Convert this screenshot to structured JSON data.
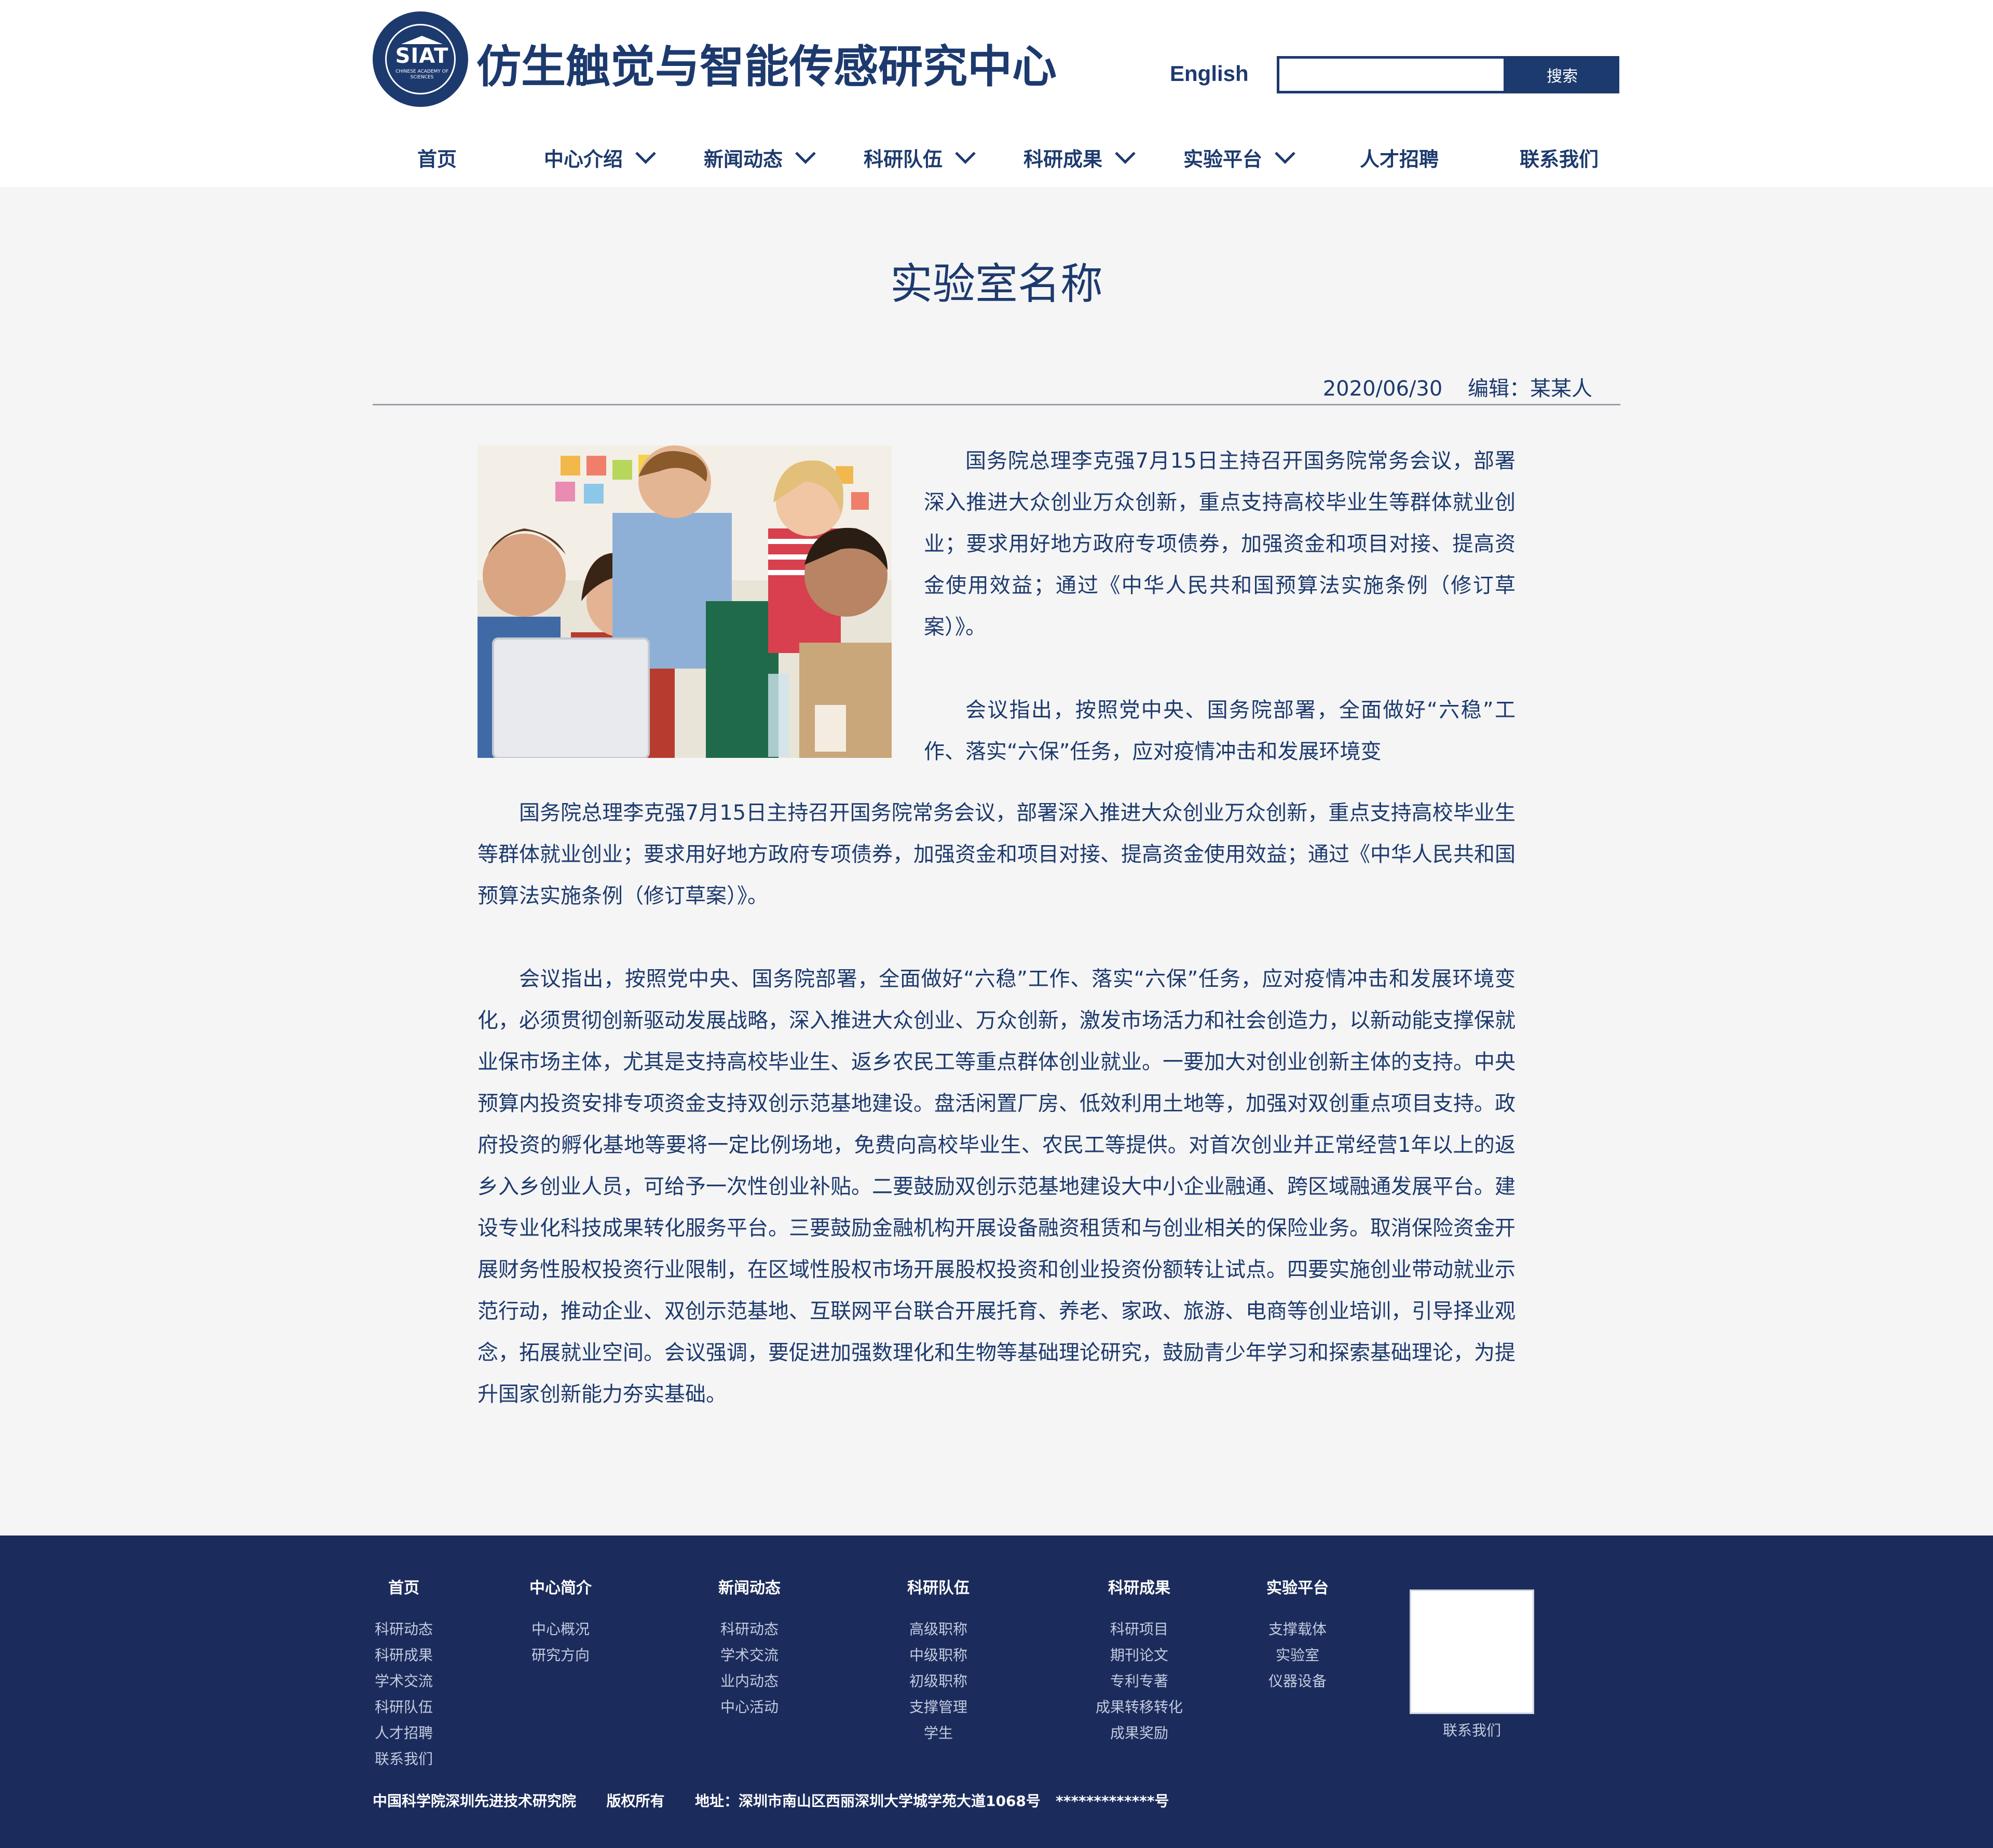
{
  "header": {
    "logo_text": "SIAT",
    "logo_sub": "CHINESE ACADEMY OF SCIENCES",
    "site_title": "仿生触觉与智能传感研究中心",
    "english_label": "English",
    "search_placeholder": "",
    "search_button": "搜索"
  },
  "nav": [
    {
      "label": "首页",
      "has_dropdown": false
    },
    {
      "label": "中心介绍",
      "has_dropdown": true
    },
    {
      "label": "新闻动态",
      "has_dropdown": true
    },
    {
      "label": "科研队伍",
      "has_dropdown": true
    },
    {
      "label": "科研成果",
      "has_dropdown": true
    },
    {
      "label": "实验平台",
      "has_dropdown": true
    },
    {
      "label": "人才招聘",
      "has_dropdown": false
    },
    {
      "label": "联系我们",
      "has_dropdown": false
    }
  ],
  "article": {
    "title": "实验室名称",
    "date": "2020/06/30",
    "editor": "编辑：某某人",
    "paragraphs": [
      "国务院总理李克强7月15日主持召开国务院常务会议，部署深入推进大众创业万众创新，重点支持高校毕业生等群体就业创业；要求用好地方政府专项债券，加强资金和项目对接、提高资金使用效益；通过《中华人民共和国预算法实施条例（修订草案）》。",
      "会议指出，按照党中央、国务院部署，全面做好“六稳”工作、落实“六保”任务，应对疫情冲击和发展环境变",
      "国务院总理李克强7月15日主持召开国务院常务会议，部署深入推进大众创业万众创新，重点支持高校毕业生等群体就业创业；要求用好地方政府专项债券，加强资金和项目对接、提高资金使用效益；通过《中华人民共和国预算法实施条例（修订草案）》。",
      "会议指出，按照党中央、国务院部署，全面做好“六稳”工作、落实“六保”任务，应对疫情冲击和发展环境变化，必须贯彻创新驱动发展战略，深入推进大众创业、万众创新，激发市场活力和社会创造力，以新动能支撑保就业保市场主体，尤其是支持高校毕业生、返乡农民工等重点群体创业就业。一要加大对创业创新主体的支持。中央预算内投资安排专项资金支持双创示范基地建设。盘活闲置厂房、低效利用土地等，加强对双创重点项目支持。政府投资的孵化基地等要将一定比例场地，免费向高校毕业生、农民工等提供。对首次创业并正常经营1年以上的返乡入乡创业人员，可给予一次性创业补贴。二要鼓励双创示范基地建设大中小企业融通、跨区域融通发展平台。建设专业化科技成果转化服务平台。三要鼓励金融机构开展设备融资租赁和与创业相关的保险业务。取消保险资金开展财务性股权投资行业限制，在区域性股权市场开展股权投资和创业投资份额转让试点。四要实施创业带动就业示范行动，推动企业、双创示范基地、互联网平台联合开展托育、养老、家政、旅游、电商等创业培训，引导择业观念，拓展就业空间。会议强调，要促进加强数理化和生物等基础理论研究，鼓励青少年学习和探索基础理论，为提升国家创新能力夯实基础。"
    ]
  },
  "footer": {
    "columns": [
      {
        "title": "首页",
        "links": [
          "科研动态",
          "科研成果",
          "学术交流",
          "科研队伍",
          "人才招聘",
          "联系我们"
        ]
      },
      {
        "title": "中心简介",
        "links": [
          "中心概况",
          "研究方向"
        ]
      },
      {
        "title": "新闻动态",
        "links": [
          "科研动态",
          "学术交流",
          "业内动态",
          "中心活动"
        ]
      },
      {
        "title": "科研队伍",
        "links": [
          "高级职称",
          "中级职称",
          "初级职称",
          "支撑管理",
          "学生"
        ]
      },
      {
        "title": "科研成果",
        "links": [
          "科研项目",
          "期刊论文",
          "专利专著",
          "成果转移转化",
          "成果奖励"
        ]
      },
      {
        "title": "实验平台",
        "links": [
          "支撑载体",
          "实验室",
          "仪器设备"
        ]
      }
    ],
    "qr_label": "联系我们",
    "copyright": "中国科学院深圳先进技术研究院      版权所有      地址：深圳市南山区西丽深圳大学城学苑大道1068号   *************号"
  },
  "colors": {
    "brand": "#1d3a6e",
    "footer_bg": "#1b2c5c",
    "page_bg": "#f5f5f5"
  }
}
